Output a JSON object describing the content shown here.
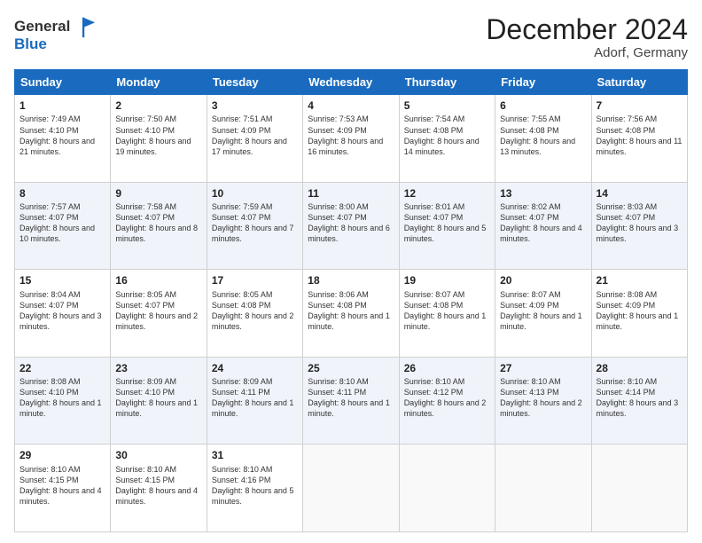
{
  "logo": {
    "general": "General",
    "blue": "Blue"
  },
  "title": "December 2024",
  "location": "Adorf, Germany",
  "days_of_week": [
    "Sunday",
    "Monday",
    "Tuesday",
    "Wednesday",
    "Thursday",
    "Friday",
    "Saturday"
  ],
  "weeks": [
    [
      {
        "day": "1",
        "info": "Sunrise: 7:49 AM\nSunset: 4:10 PM\nDaylight: 8 hours and 21 minutes."
      },
      {
        "day": "2",
        "info": "Sunrise: 7:50 AM\nSunset: 4:10 PM\nDaylight: 8 hours and 19 minutes."
      },
      {
        "day": "3",
        "info": "Sunrise: 7:51 AM\nSunset: 4:09 PM\nDaylight: 8 hours and 17 minutes."
      },
      {
        "day": "4",
        "info": "Sunrise: 7:53 AM\nSunset: 4:09 PM\nDaylight: 8 hours and 16 minutes."
      },
      {
        "day": "5",
        "info": "Sunrise: 7:54 AM\nSunset: 4:08 PM\nDaylight: 8 hours and 14 minutes."
      },
      {
        "day": "6",
        "info": "Sunrise: 7:55 AM\nSunset: 4:08 PM\nDaylight: 8 hours and 13 minutes."
      },
      {
        "day": "7",
        "info": "Sunrise: 7:56 AM\nSunset: 4:08 PM\nDaylight: 8 hours and 11 minutes."
      }
    ],
    [
      {
        "day": "8",
        "info": "Sunrise: 7:57 AM\nSunset: 4:07 PM\nDaylight: 8 hours and 10 minutes."
      },
      {
        "day": "9",
        "info": "Sunrise: 7:58 AM\nSunset: 4:07 PM\nDaylight: 8 hours and 8 minutes."
      },
      {
        "day": "10",
        "info": "Sunrise: 7:59 AM\nSunset: 4:07 PM\nDaylight: 8 hours and 7 minutes."
      },
      {
        "day": "11",
        "info": "Sunrise: 8:00 AM\nSunset: 4:07 PM\nDaylight: 8 hours and 6 minutes."
      },
      {
        "day": "12",
        "info": "Sunrise: 8:01 AM\nSunset: 4:07 PM\nDaylight: 8 hours and 5 minutes."
      },
      {
        "day": "13",
        "info": "Sunrise: 8:02 AM\nSunset: 4:07 PM\nDaylight: 8 hours and 4 minutes."
      },
      {
        "day": "14",
        "info": "Sunrise: 8:03 AM\nSunset: 4:07 PM\nDaylight: 8 hours and 3 minutes."
      }
    ],
    [
      {
        "day": "15",
        "info": "Sunrise: 8:04 AM\nSunset: 4:07 PM\nDaylight: 8 hours and 3 minutes."
      },
      {
        "day": "16",
        "info": "Sunrise: 8:05 AM\nSunset: 4:07 PM\nDaylight: 8 hours and 2 minutes."
      },
      {
        "day": "17",
        "info": "Sunrise: 8:05 AM\nSunset: 4:08 PM\nDaylight: 8 hours and 2 minutes."
      },
      {
        "day": "18",
        "info": "Sunrise: 8:06 AM\nSunset: 4:08 PM\nDaylight: 8 hours and 1 minute."
      },
      {
        "day": "19",
        "info": "Sunrise: 8:07 AM\nSunset: 4:08 PM\nDaylight: 8 hours and 1 minute."
      },
      {
        "day": "20",
        "info": "Sunrise: 8:07 AM\nSunset: 4:09 PM\nDaylight: 8 hours and 1 minute."
      },
      {
        "day": "21",
        "info": "Sunrise: 8:08 AM\nSunset: 4:09 PM\nDaylight: 8 hours and 1 minute."
      }
    ],
    [
      {
        "day": "22",
        "info": "Sunrise: 8:08 AM\nSunset: 4:10 PM\nDaylight: 8 hours and 1 minute."
      },
      {
        "day": "23",
        "info": "Sunrise: 8:09 AM\nSunset: 4:10 PM\nDaylight: 8 hours and 1 minute."
      },
      {
        "day": "24",
        "info": "Sunrise: 8:09 AM\nSunset: 4:11 PM\nDaylight: 8 hours and 1 minute."
      },
      {
        "day": "25",
        "info": "Sunrise: 8:10 AM\nSunset: 4:11 PM\nDaylight: 8 hours and 1 minute."
      },
      {
        "day": "26",
        "info": "Sunrise: 8:10 AM\nSunset: 4:12 PM\nDaylight: 8 hours and 2 minutes."
      },
      {
        "day": "27",
        "info": "Sunrise: 8:10 AM\nSunset: 4:13 PM\nDaylight: 8 hours and 2 minutes."
      },
      {
        "day": "28",
        "info": "Sunrise: 8:10 AM\nSunset: 4:14 PM\nDaylight: 8 hours and 3 minutes."
      }
    ],
    [
      {
        "day": "29",
        "info": "Sunrise: 8:10 AM\nSunset: 4:15 PM\nDaylight: 8 hours and 4 minutes."
      },
      {
        "day": "30",
        "info": "Sunrise: 8:10 AM\nSunset: 4:15 PM\nDaylight: 8 hours and 4 minutes."
      },
      {
        "day": "31",
        "info": "Sunrise: 8:10 AM\nSunset: 4:16 PM\nDaylight: 8 hours and 5 minutes."
      },
      null,
      null,
      null,
      null
    ]
  ]
}
